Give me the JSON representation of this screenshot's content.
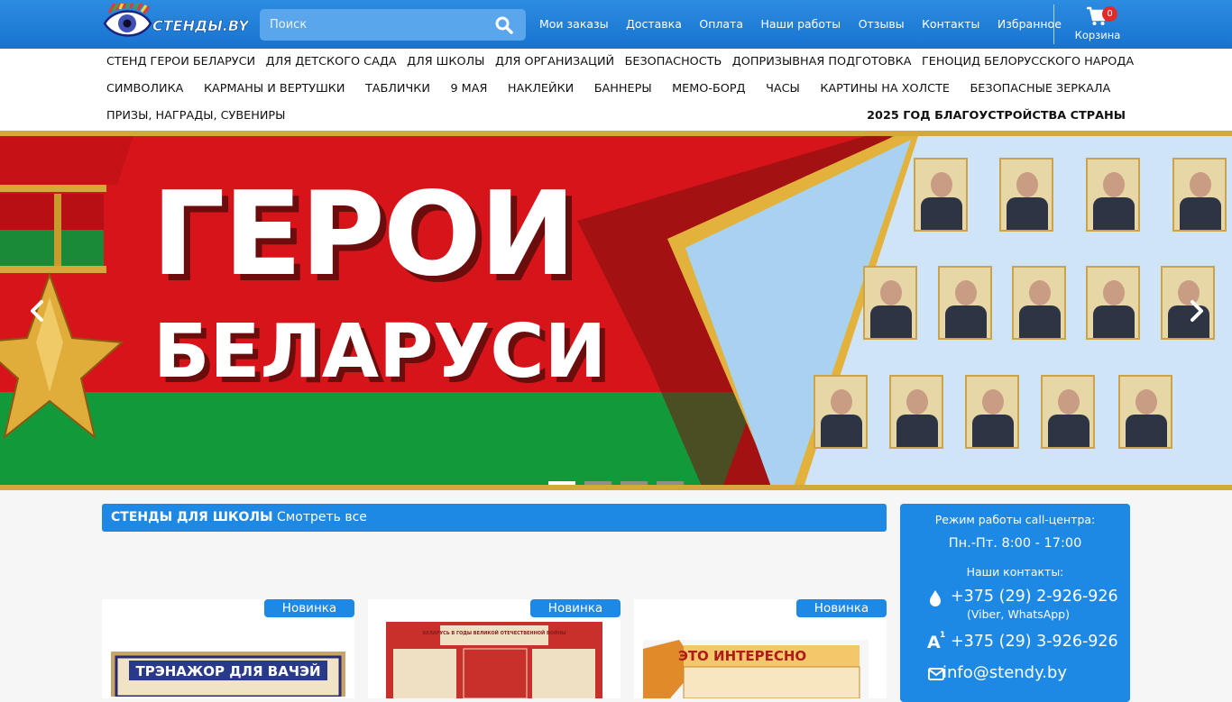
{
  "header": {
    "logo_text": "СТЕНДЫ.BY",
    "search": {
      "placeholder": "Поиск"
    },
    "nav": [
      "Мои заказы",
      "Доставка",
      "Оплата",
      "Наши работы",
      "Отзывы",
      "Контакты",
      "Избранное"
    ],
    "cart": {
      "label": "Корзина",
      "count": "0"
    }
  },
  "categories": {
    "row1": [
      "СТЕНД ГЕРОИ БЕЛАРУСИ",
      "ДЛЯ ДЕТСКОГО САДА",
      "ДЛЯ ШКОЛЫ",
      "ДЛЯ ОРГАНИЗАЦИЙ",
      "БЕЗОПАСНОСТЬ",
      "ДОПРИЗЫВНАЯ ПОДГОТОВКА",
      "ГЕНОЦИД БЕЛОРУССКОГО НАРОДА"
    ],
    "row2": [
      "СИМВОЛИКА",
      "КАРМАНЫ И ВЕРТУШКИ",
      "ТАБЛИЧКИ",
      "9 МАЯ",
      "НАКЛЕЙКИ",
      "БАННЕРЫ",
      "МЕМО-БОРД",
      "ЧАСЫ",
      "КАРТИНЫ НА ХОЛСТЕ",
      "БЕЗОПАСНЫЕ ЗЕРКАЛА"
    ],
    "row3": [
      "ПРИЗЫ, НАГРАДЫ, СУВЕНИРЫ"
    ],
    "highlight": "2025 ГОД БЛАГОУСТРОЙСТВА СТРАНЫ"
  },
  "banner": {
    "title_line1": "ГЕРОИ",
    "title_line2": "БЕЛАРУСИ",
    "slides": 4,
    "active_slide": 1
  },
  "section": {
    "title": "СТЕНДЫ ДЛЯ ШКОЛЫ",
    "link": "Смотреть все"
  },
  "products": [
    {
      "badge": "Новинка",
      "image_text": "ТРЭНАЖОР ДЛЯ ВАЧЭЙ"
    },
    {
      "badge": "Новинка",
      "image_text": "БЕЛАРУСЬ В ГОДЫ ВЕЛИКОЙ ОТЕЧЕСТВЕННОЙ ВОЙНЫ"
    },
    {
      "badge": "Новинка",
      "image_text": "ЭТО ИНТЕРЕСНО"
    }
  ],
  "sidebar": {
    "hours_label": "Режим работы call-центра:",
    "hours": "Пн.-Пт. 8:00 - 17:00",
    "contacts_label": "Наши контакты:",
    "phone1": "+375 (29) 2-926-926",
    "phone1_note": "(Viber, WhatsApp)",
    "phone2": "+375 (29) 3-926-926",
    "email": "info@stendy.by"
  }
}
